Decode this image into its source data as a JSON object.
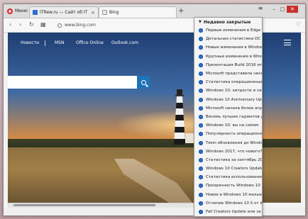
{
  "browser": {
    "menu_label": "Меню",
    "tabs": [
      {
        "title": "ITRew.ru — Сайт об IT дл",
        "favicon_color": "#2a6ecf"
      },
      {
        "title": "Bing",
        "favicon_color": "#f0f0f0"
      }
    ],
    "new_tab": "+",
    "url": "www.bing.com",
    "window_controls": [
      "minimize",
      "maximize",
      "close"
    ]
  },
  "bing": {
    "nav": [
      "Новости",
      "MSN",
      "Office Online",
      "Outlook.com"
    ],
    "search_placeholder": ""
  },
  "recently_closed": {
    "header": "Недавно закрытые",
    "items": [
      "Первые изменения в Edge и",
      "Детальная статистика ОС за",
      "Новые изменения в Window",
      "Крупные изменения в Windo",
      "Презентация Build 2016 итог",
      "Microsoft представила неску",
      "Статистика операционных с",
      "Windows 10: хитрости и секр",
      "Windows 10 Anniversary Upd",
      "Microsoft начала более агрес",
      "Восемь лучших гаджетов для",
      "Windows 10: вы на самом",
      "Популярность операционны",
      "Темп обновления до Windo",
      "Windows 2017, что нового?",
      "Статистика за сентябрь 2016",
      "Windows 10 Creators Update",
      "Статистика использования о",
      "Прозрачность Windows 10 и",
      "Новое в Windows 10 малых",
      "Отличие Windows 10 S от Wi",
      "Fall Creators Update или за"
    ]
  }
}
